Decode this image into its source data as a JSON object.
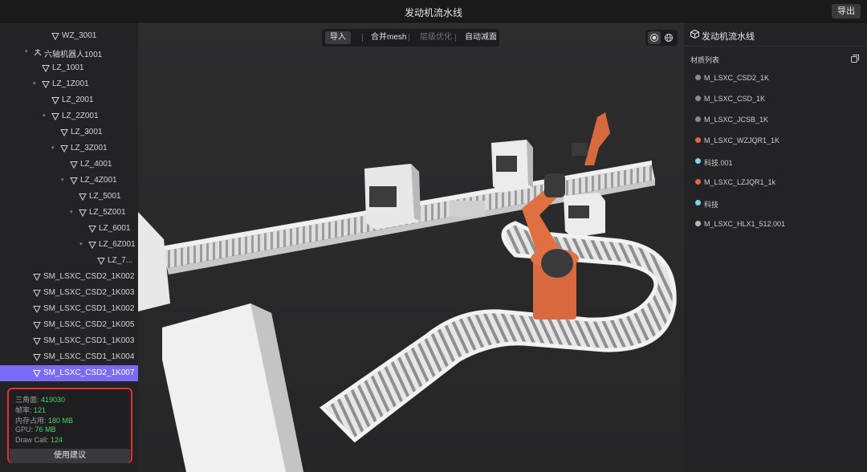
{
  "app": {
    "title": "发动机流水线",
    "export_label": "导出"
  },
  "tree": [
    {
      "label": "WZ_3001",
      "indent": 64,
      "arrow": false,
      "icon": "mesh-triangle-icon"
    },
    {
      "label": "六轴机器人1001",
      "indent": 42,
      "arrow": true,
      "icon": "robot-icon"
    },
    {
      "label": "LZ_1001",
      "indent": 52,
      "arrow": false,
      "icon": "mesh-triangle-icon"
    },
    {
      "label": "LZ_1Z001",
      "indent": 52,
      "arrow": true,
      "icon": "mesh-triangle-icon"
    },
    {
      "label": "LZ_2001",
      "indent": 64,
      "arrow": false,
      "icon": "mesh-triangle-icon"
    },
    {
      "label": "LZ_2Z001",
      "indent": 64,
      "arrow": true,
      "icon": "mesh-triangle-icon"
    },
    {
      "label": "LZ_3001",
      "indent": 75,
      "arrow": false,
      "icon": "mesh-triangle-icon"
    },
    {
      "label": "LZ_3Z001",
      "indent": 75,
      "arrow": true,
      "icon": "mesh-triangle-icon"
    },
    {
      "label": "LZ_4001",
      "indent": 87,
      "arrow": false,
      "icon": "mesh-triangle-icon"
    },
    {
      "label": "LZ_4Z001",
      "indent": 87,
      "arrow": true,
      "icon": "mesh-triangle-icon"
    },
    {
      "label": "LZ_5001",
      "indent": 98,
      "arrow": false,
      "icon": "mesh-triangle-icon"
    },
    {
      "label": "LZ_5Z001",
      "indent": 98,
      "arrow": true,
      "icon": "mesh-triangle-icon"
    },
    {
      "label": "LZ_6001",
      "indent": 110,
      "arrow": false,
      "icon": "mesh-triangle-icon"
    },
    {
      "label": "LZ_6Z001",
      "indent": 110,
      "arrow": true,
      "icon": "mesh-triangle-icon"
    },
    {
      "label": "LZ_7...",
      "indent": 121,
      "arrow": false,
      "icon": "mesh-triangle-icon"
    },
    {
      "label": "SM_LSXC_CSD2_1K002",
      "indent": 41,
      "arrow": false,
      "icon": "mesh-triangle-icon"
    },
    {
      "label": "SM_LSXC_CSD2_1K003",
      "indent": 41,
      "arrow": false,
      "icon": "mesh-triangle-icon"
    },
    {
      "label": "SM_LSXC_CSD1_1K002",
      "indent": 41,
      "arrow": false,
      "icon": "mesh-triangle-icon"
    },
    {
      "label": "SM_LSXC_CSD2_1K005",
      "indent": 41,
      "arrow": false,
      "icon": "mesh-triangle-icon"
    },
    {
      "label": "SM_LSXC_CSD1_1K003",
      "indent": 41,
      "arrow": false,
      "icon": "mesh-triangle-icon"
    },
    {
      "label": "SM_LSXC_CSD1_1K004",
      "indent": 41,
      "arrow": false,
      "icon": "mesh-triangle-icon"
    },
    {
      "label": "SM_LSXC_CSD2_1K007",
      "indent": 41,
      "arrow": false,
      "icon": "mesh-triangle-icon",
      "selected": true
    }
  ],
  "stats": {
    "triangles_label": "三角面:",
    "triangles": "419030",
    "fps_label": "帧率:",
    "fps": "121",
    "memory_label": "内存占用:",
    "memory": "180 MB",
    "gpu_label": "GPU:",
    "gpu": "76 MB",
    "drawcall_label": "Draw Call:",
    "drawcall": "124",
    "advice_label": "使用建议"
  },
  "toolbar": {
    "import": "导入",
    "merge": "合并mesh",
    "lod": "层级优化",
    "reduce": "自动减面"
  },
  "right_panel": {
    "title": "发动机流水线",
    "materials_header": "材质列表",
    "materials": [
      {
        "name": "M_LSXC_CSD2_1K",
        "color": "#8a8a8a"
      },
      {
        "name": "M_LSXC_CSD_1K",
        "color": "#8a8a8a"
      },
      {
        "name": "M_LSXC_JCSB_1K",
        "color": "#8a8a8a"
      },
      {
        "name": "M_LSXC_WZJQR1_1K",
        "color": "#e0674a"
      },
      {
        "name": "科技.001",
        "color": "#7fd4f0"
      },
      {
        "name": "M_LSXC_LZJQR1_1k",
        "color": "#e0674a"
      },
      {
        "name": "科技",
        "color": "#7fd4f0"
      },
      {
        "name": "M_LSXC_HLX1_512.001",
        "color": "#b8b8b8"
      }
    ]
  }
}
